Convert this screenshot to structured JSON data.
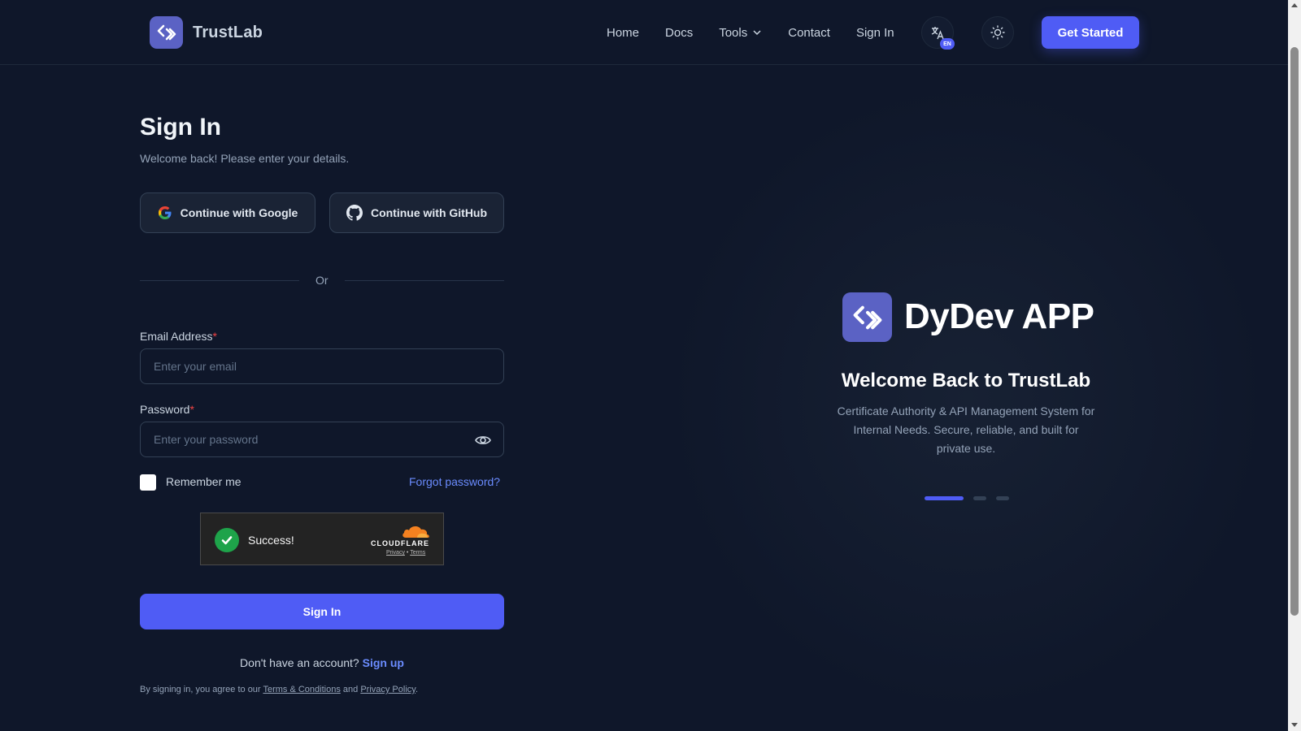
{
  "header": {
    "brand": "TrustLab",
    "nav": [
      {
        "label": "Home"
      },
      {
        "label": "Docs"
      },
      {
        "label": "Tools"
      },
      {
        "label": "Contact"
      },
      {
        "label": "Sign In"
      }
    ],
    "lang_badge": "EN",
    "cta_label": "Get Started"
  },
  "form": {
    "title": "Sign In",
    "subtitle": "Welcome back! Please enter your details.",
    "google_label": "Continue with Google",
    "github_label": "Continue with GitHub",
    "divider_text": "Or",
    "email_label": "Email Address",
    "email_placeholder": "Enter your email",
    "email_value": "",
    "password_label": "Password",
    "password_placeholder": "Enter your password",
    "password_value": "",
    "required_mark": "*",
    "remember_label": "Remember me",
    "remember_checked": false,
    "forgot_label": "Forgot password?",
    "captcha": {
      "status": "Success!",
      "provider": "CLOUDFLARE",
      "privacy": "Privacy",
      "separator": "•",
      "terms": "Terms"
    },
    "submit_label": "Sign In",
    "signup_prompt": "Don't have an account?",
    "signup_link": "Sign up",
    "terms_prefix": "By signing in, you agree to our",
    "terms_link": "Terms & Conditions",
    "terms_and": "and",
    "privacy_link": "Privacy Policy",
    "terms_suffix": "."
  },
  "promo": {
    "app_name": "DyDev APP",
    "welcome": "Welcome Back to TrustLab",
    "description": "Certificate Authority & API Management System for Internal Needs. Secure, reliable, and built for private use.",
    "carousel_active_index": 0,
    "carousel_count": 3
  },
  "colors": {
    "background": "#0f172a",
    "accent": "#4f5cf5",
    "link": "#6b8cff",
    "logo": "#5b62c4",
    "success": "#1ea34a"
  }
}
